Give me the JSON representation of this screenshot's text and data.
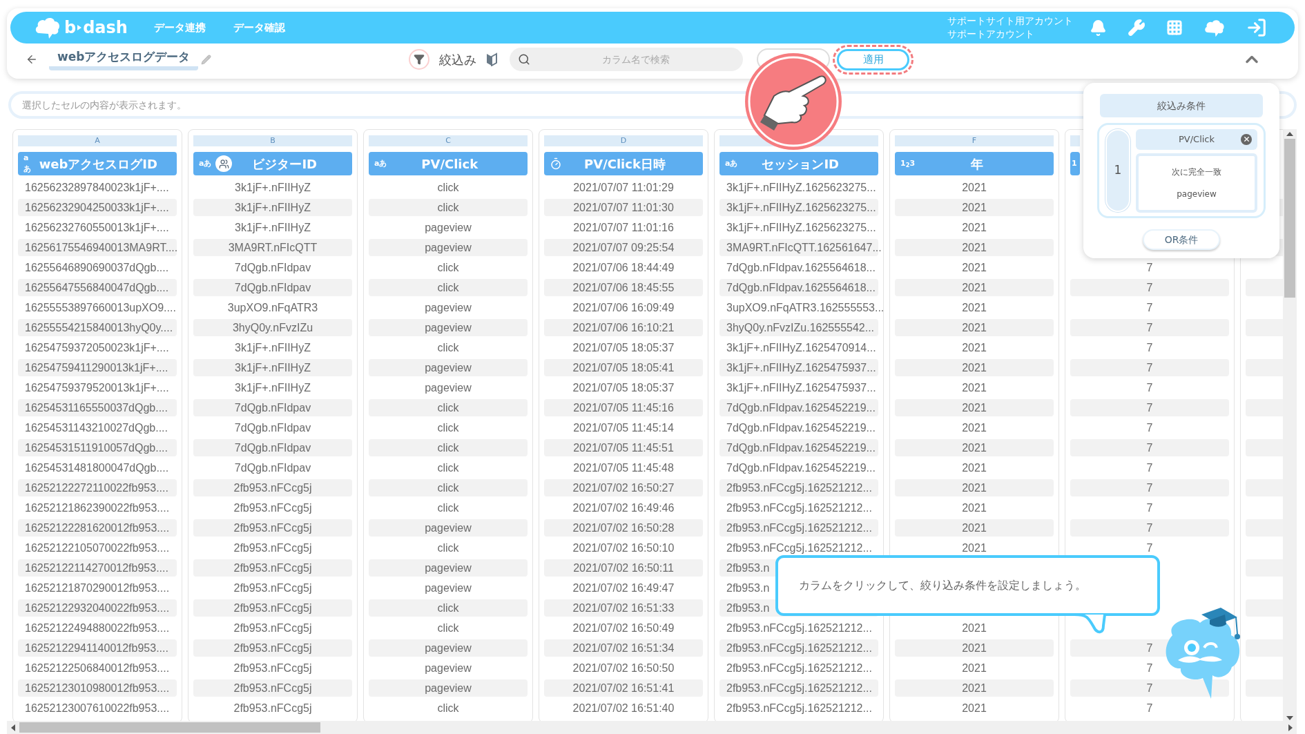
{
  "header": {
    "logo": [
      "b",
      "dash"
    ],
    "nav": [
      {
        "label": "データ連携"
      },
      {
        "label": "データ確認"
      }
    ],
    "account": [
      "サポートサイト用アカウント",
      "サポートアカウント"
    ]
  },
  "toolbar": {
    "title": "webアクセスログデータ",
    "filter_label": "絞込み",
    "search": {
      "placeholder": "カラム名で検索"
    },
    "apply_button": "適用",
    "apply_highlighted": true
  },
  "cell_content": {
    "placeholder": "選択したセルの内容が表示されます。"
  },
  "columns": [
    {
      "letter": "A",
      "label": "webアクセスログID",
      "kind": "text",
      "type_label": "aあ",
      "visitor_key": false,
      "cells": [
        "16256232897840023k1jF+....",
        "16256232904250033k1jF+....",
        "16256232760550013k1jF+....",
        "16256175546940013MA9RT....",
        "16255646890690037dQgb....",
        "16255647556840047dQgb....",
        "16255553897660013upXO9....",
        "16255554215840013hyQ0y....",
        "16254759372050023k1jF+....",
        "16254759411290013k1jF+....",
        "16254759379520013k1jF+....",
        "16254531165550037dQgb....",
        "16254531143210027dQgb....",
        "16254531511910057dQgb....",
        "16254531481800047dQgb....",
        "16252122272110022fb953....",
        "16252121862390022fb953....",
        "16252122281620012fb953....",
        "16252122105070022fb953....",
        "16252122114270012fb953....",
        "16252121870290012fb953....",
        "16252122932040022fb953....",
        "16252122494880022fb953....",
        "16252122941140012fb953....",
        "16252122506840012fb953....",
        "16252123010980012fb953....",
        "16252123007610022fb953...."
      ]
    },
    {
      "letter": "B",
      "label": "ビジターID",
      "kind": "text",
      "type_label": "aあ",
      "visitor_key": true,
      "cells": [
        "3k1jF+.nFIIHyZ",
        "3k1jF+.nFIIHyZ",
        "3k1jF+.nFIIHyZ",
        "3MA9RT.nFIcQTT",
        "7dQgb.nFIdpav",
        "7dQgb.nFIdpav",
        "3upXO9.nFqATR3",
        "3hyQ0y.nFvzIZu",
        "3k1jF+.nFIIHyZ",
        "3k1jF+.nFIIHyZ",
        "3k1jF+.nFIIHyZ",
        "7dQgb.nFIdpav",
        "7dQgb.nFIdpav",
        "7dQgb.nFIdpav",
        "7dQgb.nFIdpav",
        "2fb953.nFCcg5j",
        "2fb953.nFCcg5j",
        "2fb953.nFCcg5j",
        "2fb953.nFCcg5j",
        "2fb953.nFCcg5j",
        "2fb953.nFCcg5j",
        "2fb953.nFCcg5j",
        "2fb953.nFCcg5j",
        "2fb953.nFCcg5j",
        "2fb953.nFCcg5j",
        "2fb953.nFCcg5j",
        "2fb953.nFCcg5j"
      ]
    },
    {
      "letter": "C",
      "label": "PV/Click",
      "kind": "text",
      "type_label": "aあ",
      "visitor_key": false,
      "cells": [
        "click",
        "click",
        "pageview",
        "pageview",
        "click",
        "click",
        "pageview",
        "pageview",
        "click",
        "pageview",
        "pageview",
        "click",
        "click",
        "click",
        "click",
        "click",
        "click",
        "pageview",
        "click",
        "pageview",
        "pageview",
        "click",
        "click",
        "pageview",
        "pageview",
        "pageview",
        "click"
      ]
    },
    {
      "letter": "D",
      "label": "PV/Click日時",
      "kind": "datetime",
      "visitor_key": false,
      "cells": [
        "2021/07/07 11:01:29",
        "2021/07/07 11:01:30",
        "2021/07/07 11:01:16",
        "2021/07/07 09:25:54",
        "2021/07/06 18:44:49",
        "2021/07/06 18:45:55",
        "2021/07/06 16:09:49",
        "2021/07/06 16:10:21",
        "2021/07/05 18:05:37",
        "2021/07/05 18:05:41",
        "2021/07/05 18:05:37",
        "2021/07/05 11:45:16",
        "2021/07/05 11:45:14",
        "2021/07/05 11:45:51",
        "2021/07/05 11:45:48",
        "2021/07/02 16:50:27",
        "2021/07/02 16:49:46",
        "2021/07/02 16:50:28",
        "2021/07/02 16:50:10",
        "2021/07/02 16:50:11",
        "2021/07/02 16:49:47",
        "2021/07/02 16:51:33",
        "2021/07/02 16:50:49",
        "2021/07/02 16:51:34",
        "2021/07/02 16:50:50",
        "2021/07/02 16:51:41",
        "2021/07/02 16:51:40"
      ]
    },
    {
      "label": "セッションID",
      "kind": "text",
      "type_label": "aあ",
      "visitor_key": false,
      "cells": [
        "3k1jF+.nFIIHyZ.1625623275...",
        "3k1jF+.nFIIHyZ.1625623275...",
        "3k1jF+.nFIIHyZ.1625623275...",
        "3MA9RT.nFIcQTT.162561647...",
        "7dQgb.nFIdpav.1625564618...",
        "7dQgb.nFIdpav.1625564618...",
        "3upXO9.nFqATR3.162555553...",
        "3hyQ0y.nFvzIZu.162555542...",
        "3k1jF+.nFIIHyZ.1625470914...",
        "3k1jF+.nFIIHyZ.1625475937...",
        "3k1jF+.nFIIHyZ.1625475937...",
        "7dQgb.nFIdpav.1625452219...",
        "7dQgb.nFIdpav.1625452219...",
        "7dQgb.nFIdpav.1625452219...",
        "7dQgb.nFIdpav.1625452219...",
        "2fb953.nFCcg5j.162521212...",
        "2fb953.nFCcg5j.162521212...",
        "2fb953.nFCcg5j.162521212...",
        "2fb953.nFCcg5j.162521212...",
        "2fb953.n",
        "2fb953.n",
        "2fb953.n",
        "2fb953.nFCcg5j.162521212...",
        "2fb953.nFCcg5j.162521212...",
        "2fb953.nFCcg5j.162521212...",
        "2fb953.nFCcg5j.162521212...",
        "2fb953.nFCcg5j.162521212..."
      ]
    },
    {
      "letter": "F",
      "label": "年",
      "kind": "number",
      "type_label": "1$_{2}$3",
      "visitor_key": false,
      "cells": [
        "2021",
        "2021",
        "2021",
        "2021",
        "2021",
        "2021",
        "2021",
        "2021",
        "2021",
        "2021",
        "2021",
        "2021",
        "2021",
        "2021",
        "2021",
        "2021",
        "2021",
        "2021",
        "2021",
        null,
        null,
        null,
        "2021",
        "2021",
        "2021",
        "2021",
        "2021"
      ]
    },
    {
      "kind": "number",
      "type_label": "1",
      "cells": [
        null,
        null,
        null,
        null,
        "7",
        "7",
        "7",
        "7",
        "7",
        "7",
        "7",
        "7",
        "7",
        "7",
        "7",
        "7",
        "7",
        "7",
        "7",
        null,
        null,
        null,
        null,
        "7",
        "7",
        "7",
        "7"
      ]
    }
  ],
  "filter_panel": {
    "title": "絞込み条件",
    "conditions": [
      {
        "index": "1",
        "column": "PV/Click",
        "operator": "次に完全一致",
        "value": "pageview"
      }
    ],
    "or_button": "OR条件"
  },
  "tutorial": {
    "message": "カラムをクリックして、絞り込み条件を設定しましょう。"
  }
}
